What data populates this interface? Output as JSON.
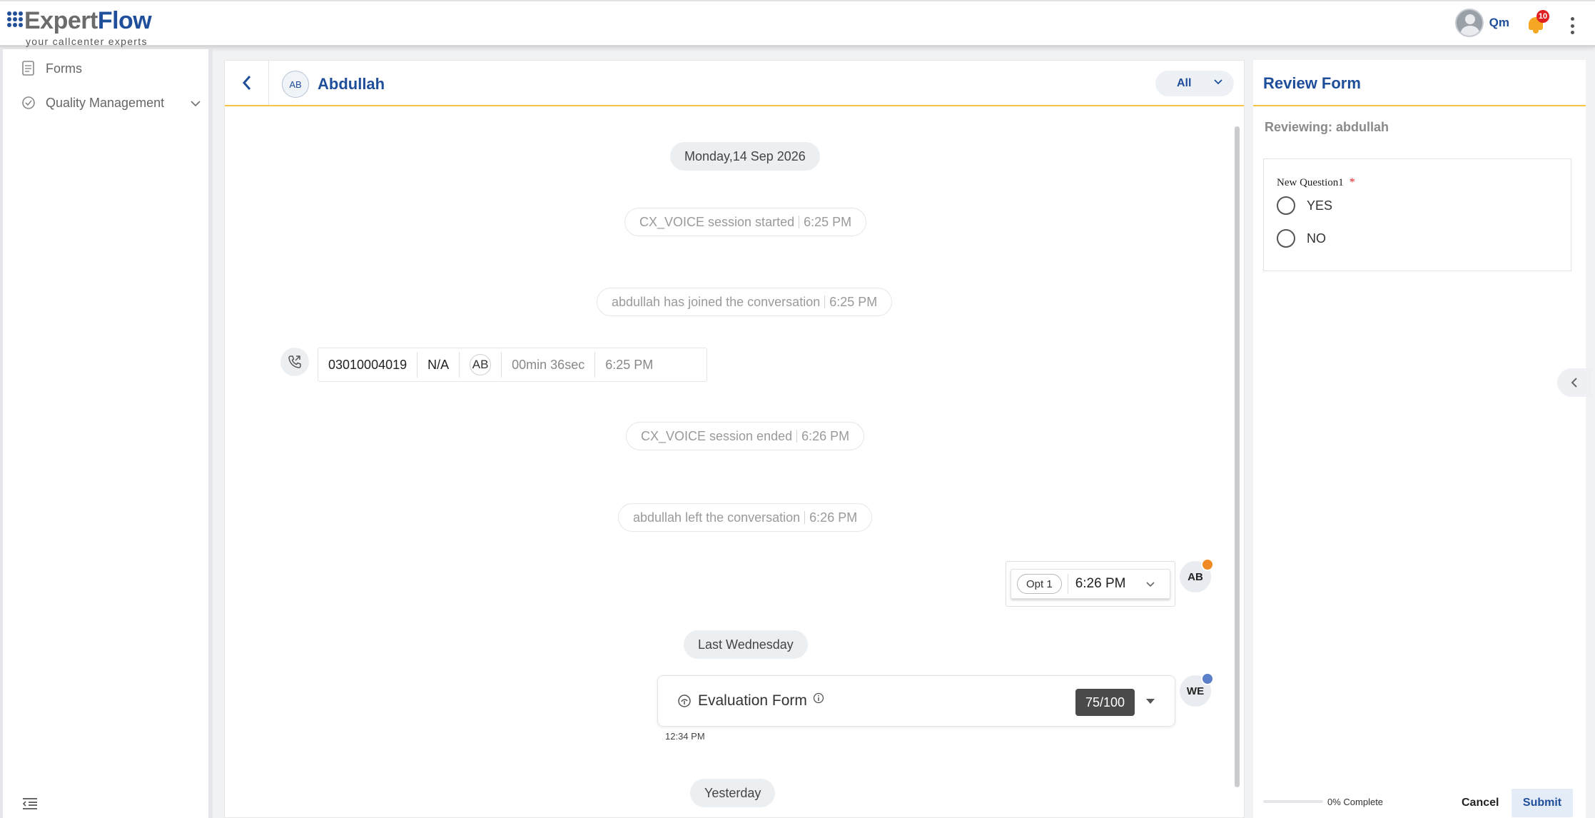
{
  "brand": {
    "name_part1": "Expert",
    "name_part2": "Flow",
    "tagline": "your callcenter experts"
  },
  "header": {
    "user_initials": "Qm",
    "notification_count": "10"
  },
  "sidebar": {
    "items": [
      {
        "label": "Forms",
        "icon": "form-icon"
      },
      {
        "label": "Quality Management",
        "icon": "quality-check-icon",
        "expandable": true
      }
    ]
  },
  "conversation": {
    "customer_initials": "AB",
    "customer_name": "Abdullah",
    "filter_value": "All",
    "timeline": {
      "date_1": "Monday,14 Sep 2026",
      "event_1": {
        "text": "CX_VOICE session started",
        "time": "6:25 PM"
      },
      "event_2": {
        "text": "abdullah has joined the conversation",
        "time": "6:25 PM"
      },
      "call": {
        "number": "03010004019",
        "status": "N/A",
        "agent": "AB",
        "duration": "00min 36sec",
        "time": "6:25 PM"
      },
      "event_3": {
        "text": "CX_VOICE session ended",
        "time": "6:26 PM"
      },
      "event_4": {
        "text": "abdullah left the conversation",
        "time": "6:26 PM"
      },
      "option_message": {
        "chip": "Opt 1",
        "time": "6:26 PM",
        "sender": "AB"
      },
      "date_2": "Last Wednesday",
      "evaluation": {
        "title": "Evaluation Form",
        "score": "75/100",
        "time": "12:34 PM",
        "sender": "WE"
      },
      "date_3": "Yesterday"
    }
  },
  "review_form": {
    "title": "Review Form",
    "reviewing": "Reviewing: abdullah",
    "question": {
      "label": "New Question1",
      "required_mark": "*",
      "options": [
        "YES",
        "NO"
      ]
    },
    "progress_percent": 0,
    "progress_label": "0% Complete",
    "cancel_label": "Cancel",
    "submit_label": "Submit"
  },
  "colors": {
    "brand_blue": "#1f4e9a",
    "accent_yellow": "#f6c543",
    "notification_red": "#e02020"
  }
}
